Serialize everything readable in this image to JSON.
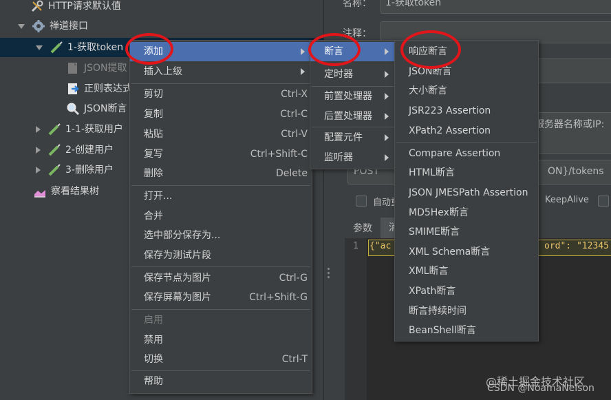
{
  "tree": {
    "items": [
      {
        "label": "HTTP请求默认值",
        "icon": "wrench-icon"
      },
      {
        "label": "禅道接口",
        "icon": "gear-icon"
      },
      {
        "label": "1-获取token",
        "icon": "pen-icon"
      },
      {
        "label": "JSON提取",
        "icon": "json-extractor-icon"
      },
      {
        "label": "正则表达式",
        "icon": "regex-extractor-icon"
      },
      {
        "label": "JSON断言",
        "icon": "magnifier-icon"
      },
      {
        "label": "1-1-获取用户",
        "icon": "pen-icon"
      },
      {
        "label": "2-创建用户",
        "icon": "pen-icon"
      },
      {
        "label": "3-删除用户",
        "icon": "pen-icon"
      },
      {
        "label": "察看结果树",
        "icon": "chart-icon"
      }
    ]
  },
  "right_panel": {
    "name_label": "名称：",
    "name_value": "1-获取token",
    "comment_label": "注释：",
    "server_label": "服务器名称或IP:",
    "method_value": "POST",
    "path_value": "ON}/tokens",
    "auto_redirect_label": "自动重",
    "keepalive_label": "KeepAlive",
    "tab_params": "参数",
    "tab_body": "消",
    "line_number": "1",
    "code_left": "{\"ac",
    "code_right": "ord\": \"12345"
  },
  "context_menu": {
    "items": [
      {
        "label": "添加",
        "shortcut": "",
        "submenu": true
      },
      {
        "label": "插入上级",
        "shortcut": "",
        "submenu": true
      },
      {
        "label": "剪切",
        "shortcut": "Ctrl-X"
      },
      {
        "label": "复制",
        "shortcut": "Ctrl-C"
      },
      {
        "label": "粘贴",
        "shortcut": "Ctrl-V"
      },
      {
        "label": "复写",
        "shortcut": "Ctrl+Shift-C"
      },
      {
        "label": "删除",
        "shortcut": "Delete"
      },
      {
        "label": "打开...",
        "shortcut": ""
      },
      {
        "label": "合并",
        "shortcut": ""
      },
      {
        "label": "选中部分保存为...",
        "shortcut": ""
      },
      {
        "label": "保存为测试片段",
        "shortcut": ""
      },
      {
        "label": "保存节点为图片",
        "shortcut": "Ctrl-G"
      },
      {
        "label": "保存屏幕为图片",
        "shortcut": "Ctrl+Shift-G"
      },
      {
        "label": "启用",
        "shortcut": ""
      },
      {
        "label": "禁用",
        "shortcut": ""
      },
      {
        "label": "切换",
        "shortcut": "Ctrl-T"
      },
      {
        "label": "帮助",
        "shortcut": ""
      }
    ]
  },
  "add_submenu": {
    "items": [
      {
        "label": "断言"
      },
      {
        "label": "定时器"
      },
      {
        "label": "前置处理器"
      },
      {
        "label": "后置处理器"
      },
      {
        "label": "配置元件"
      },
      {
        "label": "监听器"
      }
    ]
  },
  "assertion_submenu": {
    "items": [
      {
        "label": "响应断言"
      },
      {
        "label": "JSON断言"
      },
      {
        "label": "大小断言"
      },
      {
        "label": "JSR223 Assertion"
      },
      {
        "label": "XPath2 Assertion"
      },
      {
        "label": "Compare Assertion"
      },
      {
        "label": "HTML断言"
      },
      {
        "label": "JSON JMESPath Assertion"
      },
      {
        "label": "MD5Hex断言"
      },
      {
        "label": "SMIME断言"
      },
      {
        "label": "XML Schema断言"
      },
      {
        "label": "XML断言"
      },
      {
        "label": "XPath断言"
      },
      {
        "label": "断言持续时间"
      },
      {
        "label": "BeanShell断言"
      }
    ]
  },
  "watermark": {
    "line1": "@稀土掘金技术社区",
    "line2": "CSDN @NoamaNelson"
  },
  "colors": {
    "highlight": "#4b6eaf",
    "annotation_ring": "#e0161b",
    "selected_row": "#0d293e"
  }
}
